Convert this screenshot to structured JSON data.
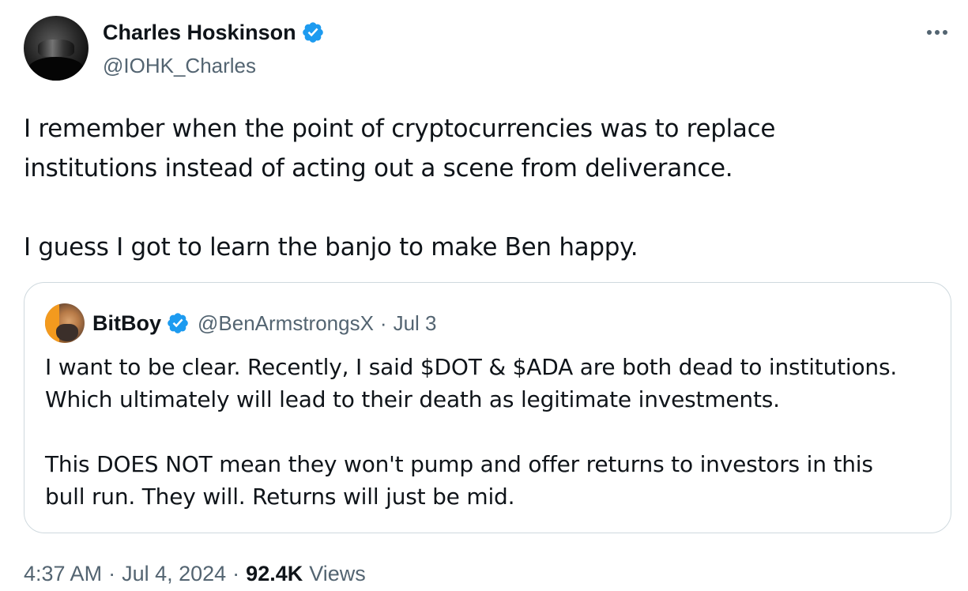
{
  "author": {
    "name": "Charles Hoskinson",
    "handle": "@IOHK_Charles",
    "verified_icon": "verified-badge-icon"
  },
  "more_icon": "more-horizontal-icon",
  "tweet": {
    "line1": "I remember when the point of cryptocurrencies was to replace",
    "line2": "institutions instead of acting out a scene from deliverance.",
    "line3": "I guess I got to learn the banjo to make Ben happy."
  },
  "quote": {
    "name": "BitBoy",
    "handle": "@BenArmstrongsX",
    "separator": "·",
    "date": "Jul 3",
    "line1": "I want to be clear. Recently, I said $DOT & $ADA are both dead to institutions.",
    "line2": "Which ultimately will lead to their death as legitimate investments.",
    "line3": "This DOES NOT mean they won't pump and offer returns to investors in this",
    "line4": "bull run. They will. Returns will just be mid."
  },
  "meta": {
    "time": "4:37 AM",
    "sep1": "·",
    "date": "Jul 4, 2024",
    "sep2": "·",
    "views_count": "92.4K",
    "views_label": "Views"
  },
  "colors": {
    "text": "#0f1419",
    "secondary": "#536471",
    "verified": "#1d9bf0",
    "border": "#cfd9de"
  }
}
